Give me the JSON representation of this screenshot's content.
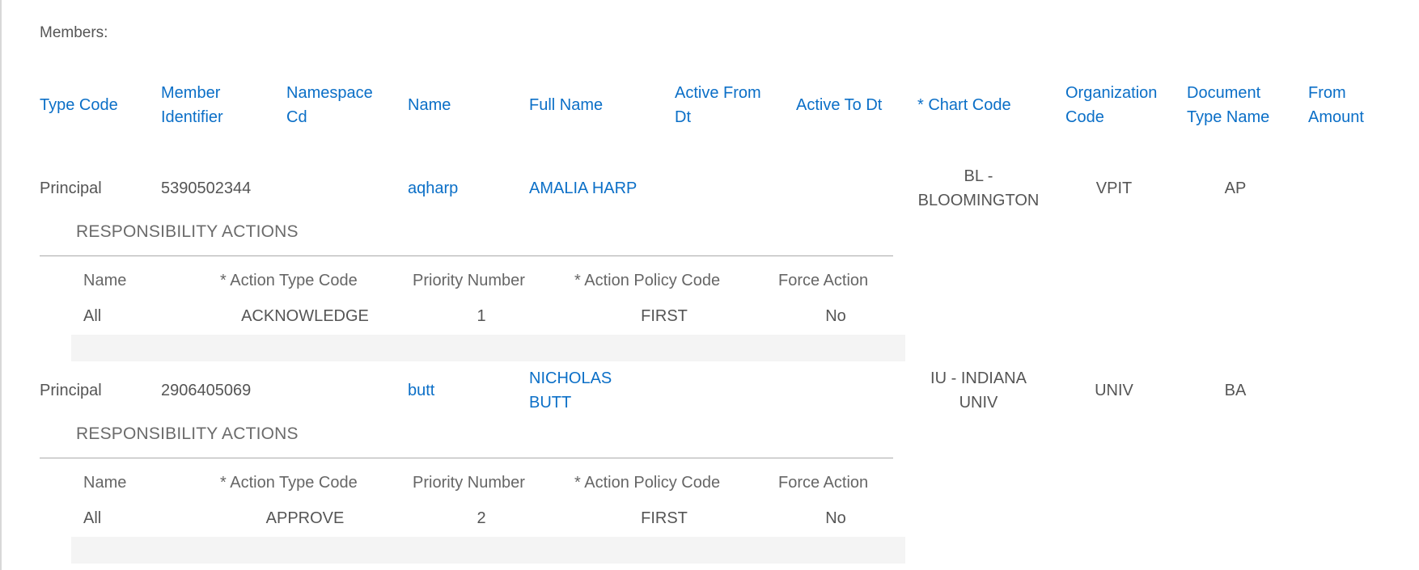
{
  "members_label": "Members:",
  "columns": {
    "type_code": "Type Code",
    "member_identifier": [
      "Member",
      "Identifier"
    ],
    "namespace_cd": [
      "Namespace",
      "Cd"
    ],
    "name": "Name",
    "full_name": "Full Name",
    "active_from_dt": [
      "Active From",
      "Dt"
    ],
    "active_to_dt": "Active To Dt",
    "chart_code": "* Chart Code",
    "organization_code": [
      "Organization",
      "Code"
    ],
    "document_type_name": [
      "Document",
      "Type Name"
    ],
    "from_amount": [
      "From",
      "Amount"
    ]
  },
  "responsibility": {
    "title": "RESPONSIBILITY ACTIONS",
    "headers": {
      "name": "Name",
      "action_type_code": "* Action Type Code",
      "priority_number": "Priority Number",
      "action_policy_code": "* Action Policy Code",
      "force_action": "Force Action"
    }
  },
  "members": [
    {
      "type_code": "Principal",
      "member_identifier": "5390502344",
      "name": "aqharp",
      "full_name": [
        "AMALIA HARP"
      ],
      "chart_code": [
        "BL -",
        "BLOOMINGTON"
      ],
      "organization_code": "VPIT",
      "document_type_name": "AP",
      "action": {
        "name": "All",
        "action_type_code": "ACKNOWLEDGE",
        "priority_number": "1",
        "action_policy_code": "FIRST",
        "force_action": "No"
      }
    },
    {
      "type_code": "Principal",
      "member_identifier": "2906405069",
      "name": "butt",
      "full_name": [
        "NICHOLAS",
        "BUTT"
      ],
      "chart_code": [
        "IU - INDIANA",
        "UNIV"
      ],
      "organization_code": "UNIV",
      "document_type_name": "BA",
      "action": {
        "name": "All",
        "action_type_code": "APPROVE",
        "priority_number": "2",
        "action_policy_code": "FIRST",
        "force_action": "No"
      }
    }
  ]
}
